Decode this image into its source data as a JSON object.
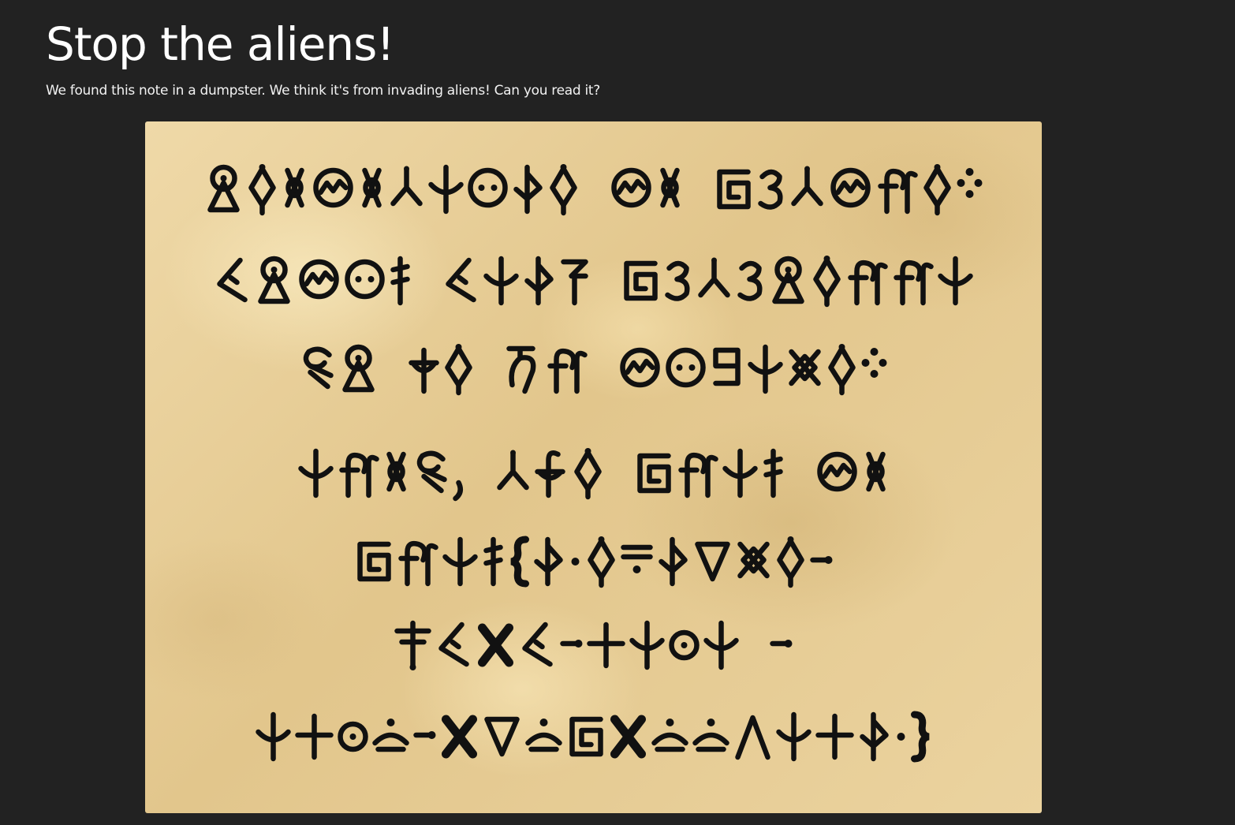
{
  "page": {
    "title": "Stop the aliens!",
    "intro": "We found this note in a dumpster. We think it's from invading aliens! Can you read it?"
  },
  "note": {
    "script": "alien-glyphs",
    "lines": [
      [
        "omega-rune",
        "diamond-pin",
        "twist-eye",
        "circle-zigzag",
        "twist-eye",
        "branch-y",
        "anchor-down",
        "circle-dot",
        "flag-hook",
        "diamond-pin",
        "space",
        "circle-zigzag",
        "twist-eye",
        "space",
        "square-spiral",
        "script-three",
        "branch-y",
        "circle-zigzag",
        "double-hook",
        "diamond-pin",
        "four-dots"
      ],
      [
        "lambda-bar",
        "omega-rune",
        "circle-zigzag",
        "circle-dot",
        "ticked-stem",
        "space",
        "lambda-bar",
        "anchor-down",
        "flag-hook",
        "flag-arrow",
        "space",
        "square-spiral",
        "script-three",
        "branch-y",
        "script-three",
        "omega-rune",
        "diamond-pin",
        "double-hook",
        "double-hook",
        "anchor-down"
      ],
      [
        "curl-rune",
        "omega-rune",
        "space",
        "cross-anchor",
        "diamond-pin",
        "space",
        "hook-ten",
        "double-hook",
        "space",
        "circle-zigzag",
        "circle-dot",
        "square-hook",
        "anchor-down",
        "lozenge-x",
        "diamond-pin",
        "four-dots"
      ],
      [
        "anchor-down",
        "double-hook",
        "twist-eye",
        "curl-rune",
        "comma",
        "space",
        "branch-y",
        "hook-anchor",
        "diamond-pin",
        "space",
        "square-spiral",
        "double-hook",
        "anchor-down",
        "ticked-stem",
        "space",
        "circle-zigzag",
        "twist-eye"
      ],
      [
        "square-spiral",
        "double-hook",
        "anchor-down",
        "ticked-stem",
        "brace-open",
        "flag-hook",
        "middle-dot",
        "diamond-pin",
        "equals-dot",
        "flag-hook",
        "triangle-down",
        "lozenge-x",
        "diamond-pin",
        "dash-dot"
      ],
      [
        "double-cross",
        "lambda-bar",
        "x-mark",
        "lambda-bar",
        "dash-dot",
        "plus-cross",
        "anchor-down",
        "circle-ring",
        "anchor-down",
        "space",
        "dash-dot"
      ],
      [
        "anchor-down",
        "plus-cross",
        "circle-ring",
        "arc-dot",
        "dash-dot",
        "x-mark",
        "triangle-down",
        "arc-dot",
        "square-spiral",
        "x-mark",
        "arc-dot",
        "arc-dot",
        "lambda-open",
        "anchor-down",
        "plus-cross",
        "flag-hook",
        "middle-dot",
        "brace-close"
      ]
    ]
  }
}
